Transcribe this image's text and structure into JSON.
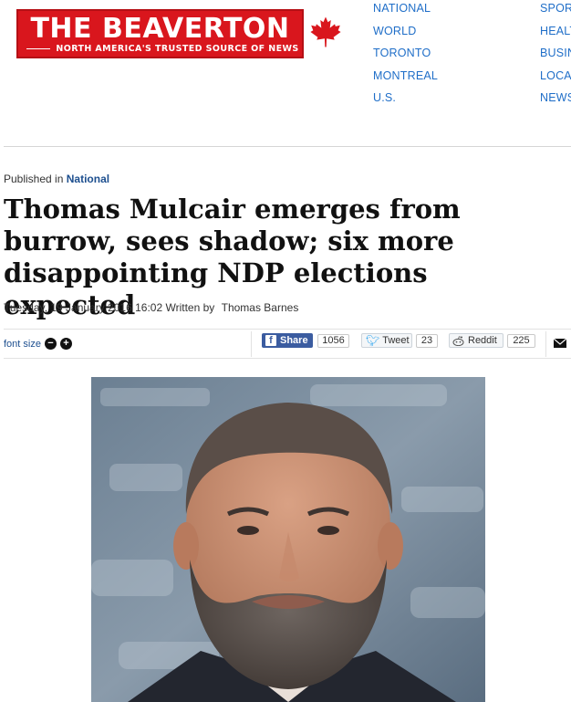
{
  "logo": {
    "title": "THE BEAVERTON",
    "tagline": "NORTH AMERICA'S TRUSTED SOURCE OF NEWS",
    "brand_color": "#d9161d"
  },
  "nav": {
    "col1": [
      "NATIONAL",
      "WORLD",
      "TORONTO",
      "MONTREAL",
      "U.S."
    ],
    "col2": [
      "SPORTS",
      "HEALTH",
      "BUSINESS",
      "LOCAL",
      "NEWS"
    ]
  },
  "article": {
    "published_prefix": "Published in",
    "category": "National",
    "headline": "Thomas Mulcair emerges from burrow, sees shadow; six more disappointing NDP elections expected",
    "date": "Tuesday, 19 January 2016 16:02",
    "written_by": "Written by",
    "author": "Thomas Barnes"
  },
  "toolbar": {
    "font_size_label": "font size",
    "decrease_symbol": "−",
    "increase_symbol": "+",
    "facebook": {
      "label": "Share",
      "count": "1056"
    },
    "twitter": {
      "label": "Tweet",
      "count": "23"
    },
    "reddit": {
      "label": "Reddit",
      "count": "225"
    }
  },
  "icons": {
    "facebook": "facebook-icon",
    "twitter": "twitter-bird-icon",
    "reddit": "reddit-alien-icon",
    "email": "envelope-icon",
    "leaf": "maple-leaf-icon"
  }
}
